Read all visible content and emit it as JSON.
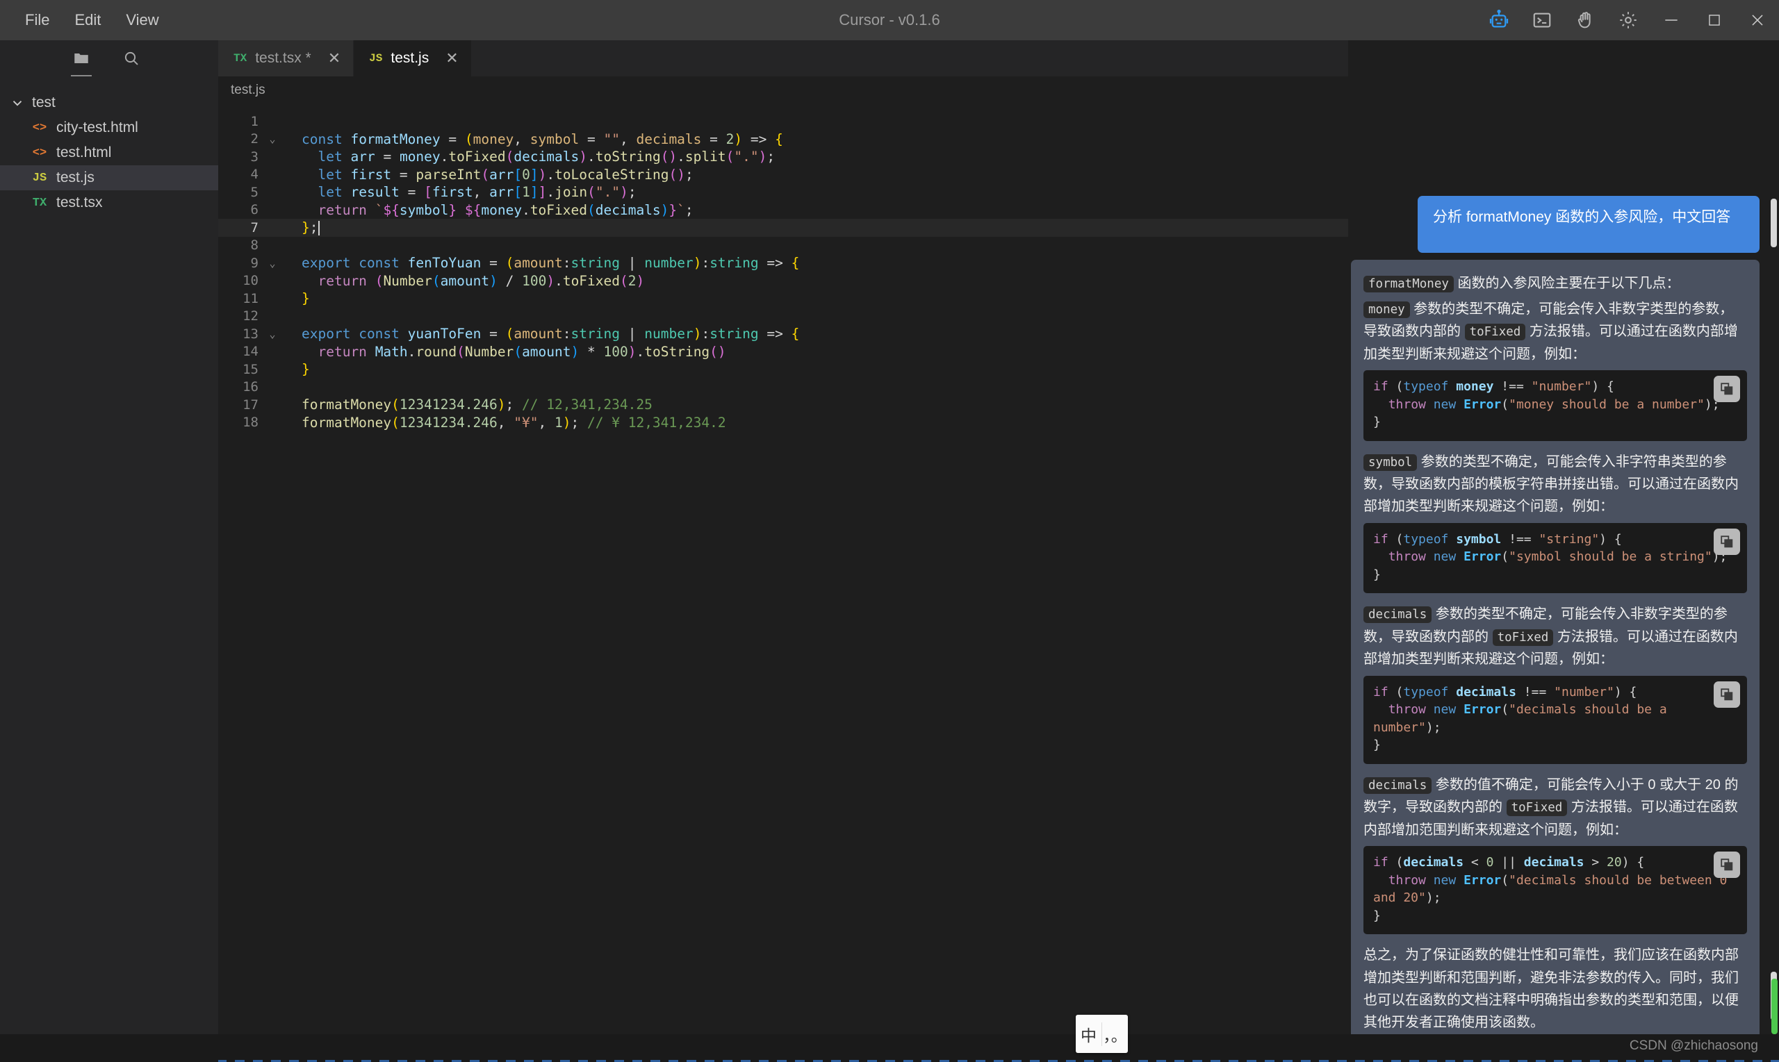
{
  "window": {
    "title": "Cursor - v0.1.6",
    "menus": [
      "File",
      "Edit",
      "View"
    ],
    "title_icons": [
      "robot-icon",
      "terminal-icon",
      "wave-hand-icon",
      "gear-icon"
    ],
    "controls": [
      "minimize",
      "maximize",
      "close"
    ]
  },
  "sidebar": {
    "tools": [
      {
        "name": "explorer-icon",
        "active": true
      },
      {
        "name": "search-icon",
        "active": false
      }
    ],
    "root": {
      "label": "test",
      "expanded": true
    },
    "files": [
      {
        "label": "city-test.html",
        "icon": "<>",
        "icon_kind": "html",
        "selected": false
      },
      {
        "label": "test.html",
        "icon": "<>",
        "icon_kind": "html",
        "selected": false
      },
      {
        "label": "test.js",
        "icon": "JS",
        "icon_kind": "js",
        "selected": true
      },
      {
        "label": "test.tsx",
        "icon": "TX",
        "icon_kind": "tsx2",
        "selected": false
      }
    ]
  },
  "tabs": [
    {
      "label": "test.tsx *",
      "icon": "TX",
      "icon_kind": "tx",
      "active": false,
      "close": "✕"
    },
    {
      "label": "test.js",
      "icon": "JS",
      "icon_kind": "js",
      "active": true,
      "close": "✕"
    }
  ],
  "breadcrumb": "test.js",
  "editor": {
    "current_line": 7,
    "lines": [
      {
        "n": "1",
        "fold": "",
        "html": ""
      },
      {
        "n": "2",
        "fold": "⌄",
        "html": "<span class=\"k\">const</span> <span class=\"va\">formatMoney</span> <span class=\"op\">=</span> <span class=\"br\">(</span><span class=\"pm\">money</span><span class=\"op\">,</span> <span class=\"pm\">symbol</span> <span class=\"op\">=</span> <span class=\"st\">\"\"</span><span class=\"op\">,</span> <span class=\"pm\">decimals</span> <span class=\"op\">=</span> <span class=\"nu\">2</span><span class=\"br\">)</span> <span class=\"op\">=&gt;</span> <span class=\"br\">{</span>"
      },
      {
        "n": "3",
        "fold": "",
        "html": "  <span class=\"k\">let</span> <span class=\"va\">arr</span> <span class=\"op\">=</span> <span class=\"va\">money</span><span class=\"op\">.</span><span class=\"fn\">toFixed</span><span class=\"br2\">(</span><span class=\"va\">decimals</span><span class=\"br2\">)</span><span class=\"op\">.</span><span class=\"fn\">toString</span><span class=\"br2\">()</span><span class=\"op\">.</span><span class=\"fn\">split</span><span class=\"br2\">(</span><span class=\"st\">\".\"</span><span class=\"br2\">)</span><span class=\"op\">;</span>"
      },
      {
        "n": "4",
        "fold": "",
        "html": "  <span class=\"k\">let</span> <span class=\"va\">first</span> <span class=\"op\">=</span> <span class=\"fn\">parseInt</span><span class=\"br2\">(</span><span class=\"va\">arr</span><span class=\"br3\">[</span><span class=\"nu\">0</span><span class=\"br3\">]</span><span class=\"br2\">)</span><span class=\"op\">.</span><span class=\"fn\">toLocaleString</span><span class=\"br2\">()</span><span class=\"op\">;</span>"
      },
      {
        "n": "5",
        "fold": "",
        "html": "  <span class=\"k\">let</span> <span class=\"va\">result</span> <span class=\"op\">=</span> <span class=\"br2\">[</span><span class=\"va\">first</span><span class=\"op\">,</span> <span class=\"va\">arr</span><span class=\"br3\">[</span><span class=\"nu\">1</span><span class=\"br3\">]</span><span class=\"br2\">]</span><span class=\"op\">.</span><span class=\"fn\">join</span><span class=\"br2\">(</span><span class=\"st\">\".\"</span><span class=\"br2\">)</span><span class=\"op\">;</span>"
      },
      {
        "n": "6",
        "fold": "",
        "html": "  <span class=\"kp\">return</span> <span class=\"st\">`</span><span class=\"br2\">${</span><span class=\"va\">symbol</span><span class=\"br2\">}</span><span class=\"st\"> </span><span class=\"br2\">${</span><span class=\"va\">money</span><span class=\"op\">.</span><span class=\"fn\">toFixed</span><span class=\"br3\">(</span><span class=\"va\">decimals</span><span class=\"br3\">)</span><span class=\"br2\">}</span><span class=\"st\">`</span><span class=\"op\">;</span>"
      },
      {
        "n": "7",
        "fold": "",
        "html": "<span class=\"br\">}</span><span class=\"op\">;</span><span class=\"cursor-caret\"></span>"
      },
      {
        "n": "8",
        "fold": "",
        "html": ""
      },
      {
        "n": "9",
        "fold": "⌄",
        "html": "<span class=\"k\">export</span> <span class=\"k\">const</span> <span class=\"va\">fenToYuan</span> <span class=\"op\">=</span> <span class=\"br\">(</span><span class=\"pm\">amount</span><span class=\"op\">:</span><span class=\"ty\">string</span> <span class=\"op\">|</span> <span class=\"ty\">number</span><span class=\"br\">)</span><span class=\"op\">:</span><span class=\"ty\">string</span> <span class=\"op\">=&gt;</span> <span class=\"br\">{</span>"
      },
      {
        "n": "10",
        "fold": "",
        "html": "  <span class=\"kp\">return</span> <span class=\"br2\">(</span><span class=\"fn\">Number</span><span class=\"br3\">(</span><span class=\"va\">amount</span><span class=\"br3\">)</span> <span class=\"op\">/</span> <span class=\"nu\">100</span><span class=\"br2\">)</span><span class=\"op\">.</span><span class=\"fn\">toFixed</span><span class=\"br2\">(</span><span class=\"nu\">2</span><span class=\"br2\">)</span>"
      },
      {
        "n": "11",
        "fold": "",
        "html": "<span class=\"br\">}</span>"
      },
      {
        "n": "12",
        "fold": "",
        "html": ""
      },
      {
        "n": "13",
        "fold": "⌄",
        "html": "<span class=\"k\">export</span> <span class=\"k\">const</span> <span class=\"va\">yuanToFen</span> <span class=\"op\">=</span> <span class=\"br\">(</span><span class=\"pm\">amount</span><span class=\"op\">:</span><span class=\"ty\">string</span> <span class=\"op\">|</span> <span class=\"ty\">number</span><span class=\"br\">)</span><span class=\"op\">:</span><span class=\"ty\">string</span> <span class=\"op\">=&gt;</span> <span class=\"br\">{</span>"
      },
      {
        "n": "14",
        "fold": "",
        "html": "  <span class=\"kp\">return</span> <span class=\"va\">Math</span><span class=\"op\">.</span><span class=\"fn\">round</span><span class=\"br2\">(</span><span class=\"fn\">Number</span><span class=\"br3\">(</span><span class=\"va\">amount</span><span class=\"br3\">)</span> <span class=\"op\">*</span> <span class=\"nu\">100</span><span class=\"br2\">)</span><span class=\"op\">.</span><span class=\"fn\">toString</span><span class=\"br2\">()</span>"
      },
      {
        "n": "15",
        "fold": "",
        "html": "<span class=\"br\">}</span>"
      },
      {
        "n": "16",
        "fold": "",
        "html": ""
      },
      {
        "n": "17",
        "fold": "",
        "html": "<span class=\"fn\">formatMoney</span><span class=\"br\">(</span><span class=\"nu\">12341234.246</span><span class=\"br\">)</span><span class=\"op\">;</span> <span class=\"cm\">// 12,341,234.25</span>"
      },
      {
        "n": "18",
        "fold": "",
        "html": "<span class=\"fn\">formatMoney</span><span class=\"br\">(</span><span class=\"nu\">12341234.246</span><span class=\"op\">,</span> <span class=\"st\">\"¥\"</span><span class=\"op\">,</span> <span class=\"nu\">1</span><span class=\"br\">)</span><span class=\"op\">;</span> <span class=\"cm\">// ¥ 12,341,234.2</span>"
      }
    ]
  },
  "chat": {
    "user_message": "分析 formatMoney 函数的入参风险，中文回答",
    "user_bubble_color": "#4285dd",
    "blocks": [
      {
        "type": "para",
        "parts": [
          {
            "code": "formatMoney"
          },
          {
            "text": " 函数的入参风险主要在于以下几点："
          }
        ]
      },
      {
        "type": "para",
        "parts": [
          {
            "code": "money"
          },
          {
            "text": " 参数的类型不确定，可能会传入非数字类型的参数，导致函数内部的 "
          },
          {
            "code": "toFixed"
          },
          {
            "text": " 方法报错。可以通过在函数内部增加类型判断来规避这个问题，例如："
          }
        ]
      },
      {
        "type": "code",
        "lines": [
          [
            {
              "t": "if",
              "c": "k"
            },
            {
              "t": " ",
              "c": "op"
            },
            {
              "t": "(",
              "c": "op"
            },
            {
              "t": "typeof",
              "c": "k2"
            },
            {
              "t": " ",
              "c": "op"
            },
            {
              "t": "money",
              "c": "va"
            },
            {
              "t": " !== ",
              "c": "op"
            },
            {
              "t": "\"number\"",
              "c": "st"
            },
            {
              "t": ") {",
              "c": "op"
            }
          ],
          [
            {
              "t": "  ",
              "c": "op"
            },
            {
              "t": "throw",
              "c": "k"
            },
            {
              "t": " ",
              "c": "op"
            },
            {
              "t": "new",
              "c": "k2"
            },
            {
              "t": " ",
              "c": "op"
            },
            {
              "t": "Error",
              "c": "ty2"
            },
            {
              "t": "(",
              "c": "op"
            },
            {
              "t": "\"money should be a number\"",
              "c": "st"
            },
            {
              "t": ");",
              "c": "op"
            }
          ],
          [
            {
              "t": "}",
              "c": "op"
            }
          ]
        ],
        "copy_label": "copy-icon"
      },
      {
        "type": "para",
        "parts": [
          {
            "code": "symbol"
          },
          {
            "text": " 参数的类型不确定，可能会传入非字符串类型的参数，导致函数内部的模板字符串拼接出错。可以通过在函数内部增加类型判断来规避这个问题，例如："
          }
        ]
      },
      {
        "type": "code",
        "lines": [
          [
            {
              "t": "if",
              "c": "k"
            },
            {
              "t": " (",
              "c": "op"
            },
            {
              "t": "typeof",
              "c": "k2"
            },
            {
              "t": " ",
              "c": "op"
            },
            {
              "t": "symbol",
              "c": "va"
            },
            {
              "t": " !== ",
              "c": "op"
            },
            {
              "t": "\"string\"",
              "c": "st"
            },
            {
              "t": ") {",
              "c": "op"
            }
          ],
          [
            {
              "t": "  ",
              "c": "op"
            },
            {
              "t": "throw",
              "c": "k"
            },
            {
              "t": " ",
              "c": "op"
            },
            {
              "t": "new",
              "c": "k2"
            },
            {
              "t": " ",
              "c": "op"
            },
            {
              "t": "Error",
              "c": "ty2"
            },
            {
              "t": "(",
              "c": "op"
            },
            {
              "t": "\"symbol should be a string\"",
              "c": "st"
            },
            {
              "t": ");",
              "c": "op"
            }
          ],
          [
            {
              "t": "}",
              "c": "op"
            }
          ]
        ],
        "copy_label": "copy-icon"
      },
      {
        "type": "para",
        "parts": [
          {
            "code": "decimals"
          },
          {
            "text": " 参数的类型不确定，可能会传入非数字类型的参数，导致函数内部的 "
          },
          {
            "code": "toFixed"
          },
          {
            "text": " 方法报错。可以通过在函数内部增加类型判断来规避这个问题，例如："
          }
        ]
      },
      {
        "type": "code",
        "lines": [
          [
            {
              "t": "if",
              "c": "k"
            },
            {
              "t": " (",
              "c": "op"
            },
            {
              "t": "typeof",
              "c": "k2"
            },
            {
              "t": " ",
              "c": "op"
            },
            {
              "t": "decimals",
              "c": "va"
            },
            {
              "t": " !== ",
              "c": "op"
            },
            {
              "t": "\"number\"",
              "c": "st"
            },
            {
              "t": ") {",
              "c": "op"
            }
          ],
          [
            {
              "t": "  ",
              "c": "op"
            },
            {
              "t": "throw",
              "c": "k"
            },
            {
              "t": " ",
              "c": "op"
            },
            {
              "t": "new",
              "c": "k2"
            },
            {
              "t": " ",
              "c": "op"
            },
            {
              "t": "Error",
              "c": "ty2"
            },
            {
              "t": "(",
              "c": "op"
            },
            {
              "t": "\"decimals should be a number\"",
              "c": "st"
            },
            {
              "t": ");",
              "c": "op"
            }
          ],
          [
            {
              "t": "}",
              "c": "op"
            }
          ]
        ],
        "copy_label": "copy-icon"
      },
      {
        "type": "para",
        "parts": [
          {
            "code": "decimals"
          },
          {
            "text": " 参数的值不确定，可能会传入小于 0 或大于 20 的数字，导致函数内部的 "
          },
          {
            "code": "toFixed"
          },
          {
            "text": " 方法报错。可以通过在函数内部增加范围判断来规避这个问题，例如："
          }
        ]
      },
      {
        "type": "code",
        "lines": [
          [
            {
              "t": "if",
              "c": "k"
            },
            {
              "t": " (",
              "c": "op"
            },
            {
              "t": "decimals",
              "c": "va"
            },
            {
              "t": " < ",
              "c": "op"
            },
            {
              "t": "0",
              "c": "nu"
            },
            {
              "t": " || ",
              "c": "op"
            },
            {
              "t": "decimals",
              "c": "va"
            },
            {
              "t": " > ",
              "c": "op"
            },
            {
              "t": "20",
              "c": "nu"
            },
            {
              "t": ") {",
              "c": "op"
            }
          ],
          [
            {
              "t": "  ",
              "c": "op"
            },
            {
              "t": "throw",
              "c": "k"
            },
            {
              "t": " ",
              "c": "op"
            },
            {
              "t": "new",
              "c": "k2"
            },
            {
              "t": " ",
              "c": "op"
            },
            {
              "t": "Error",
              "c": "ty2"
            },
            {
              "t": "(",
              "c": "op"
            },
            {
              "t": "\"decimals should be between 0 and 20\"",
              "c": "st"
            },
            {
              "t": ");",
              "c": "op"
            }
          ],
          [
            {
              "t": "}",
              "c": "op"
            }
          ]
        ],
        "copy_label": "copy-icon"
      },
      {
        "type": "para",
        "parts": [
          {
            "text": "总之，为了保证函数的健壮性和可靠性，我们应该在函数内部增加类型判断和范围判断，避免非法参数的传入。同时，我们也可以在函数的文档注释中明确指出参数的类型和范围，以便其他开发者正确使用该函数。"
          }
        ]
      }
    ]
  },
  "statusbar": {
    "ime_left": "中",
    "ime_right": "，。",
    "watermark": "CSDN @zhichaosong"
  }
}
